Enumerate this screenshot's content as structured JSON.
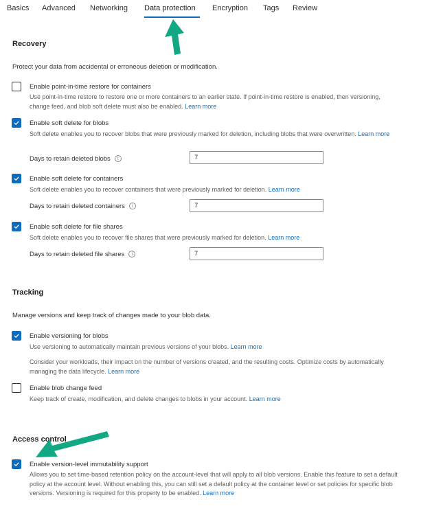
{
  "tabs": [
    {
      "label": "Basics",
      "active": false
    },
    {
      "label": "Advanced",
      "active": false
    },
    {
      "label": "Networking",
      "active": false
    },
    {
      "label": "Data protection",
      "active": true
    },
    {
      "label": "Encryption",
      "active": false
    },
    {
      "label": "Tags",
      "active": false
    },
    {
      "label": "Review",
      "active": false
    }
  ],
  "colors": {
    "accent": "#0f6cbd",
    "annotation_arrow": "#12a883",
    "text": "#323130",
    "subtext": "#605e5c"
  },
  "recovery": {
    "title": "Recovery",
    "description": "Protect your data from accidental or erroneous deletion or modification.",
    "point_in_time": {
      "label": "Enable point-in-time restore for containers",
      "checked": false,
      "description": "Use point-in-time restore to restore one or more containers to an earlier state. If point-in-time restore is enabled, then versioning, change feed, and blob soft delete must also be enabled.",
      "link": "Learn more"
    },
    "soft_delete_blobs": {
      "label": "Enable soft delete for blobs",
      "checked": true,
      "description": "Soft delete enables you to recover blobs that were previously marked for deletion, including blobs that were overwritten.",
      "link": "Learn more",
      "field_label": "Days to retain deleted blobs",
      "field_value": "7"
    },
    "soft_delete_containers": {
      "label": "Enable soft delete for containers",
      "checked": true,
      "description": "Soft delete enables you to recover containers that were previously marked for deletion.",
      "link": "Learn more",
      "field_label": "Days to retain deleted containers",
      "field_value": "7"
    },
    "soft_delete_file_shares": {
      "label": "Enable soft delete for file shares",
      "checked": true,
      "description": "Soft delete enables you to recover file shares that were previously marked for deletion.",
      "link": "Learn more",
      "field_label": "Days to retain deleted file shares",
      "field_value": "7"
    }
  },
  "tracking": {
    "title": "Tracking",
    "description": "Manage versions and keep track of changes made to your blob data.",
    "versioning": {
      "label": "Enable versioning for blobs",
      "checked": true,
      "description": "Use versioning to automatically maintain previous versions of your blobs.",
      "link": "Learn more",
      "note": "Consider your workloads, their impact on the number of versions created, and the resulting costs. Optimize costs by automatically managing the data lifecycle.",
      "note_link": "Learn more"
    },
    "change_feed": {
      "label": "Enable blob change feed",
      "checked": false,
      "description": "Keep track of create, modification, and delete changes to blobs in your account.",
      "link": "Learn more"
    }
  },
  "access_control": {
    "title": "Access control",
    "immutability": {
      "label": "Enable version-level immutability support",
      "checked": true,
      "description": "Allows you to set time-based retention policy on the account-level that will apply to all blob versions. Enable this feature to set a default policy at the account level. Without enabling this, you can still set a default policy at the container level or set policies for specific blob versions. Versioning is required for this property to be enabled.",
      "link": "Learn more"
    }
  },
  "icons": {
    "info": "i",
    "check": "checkmark"
  }
}
